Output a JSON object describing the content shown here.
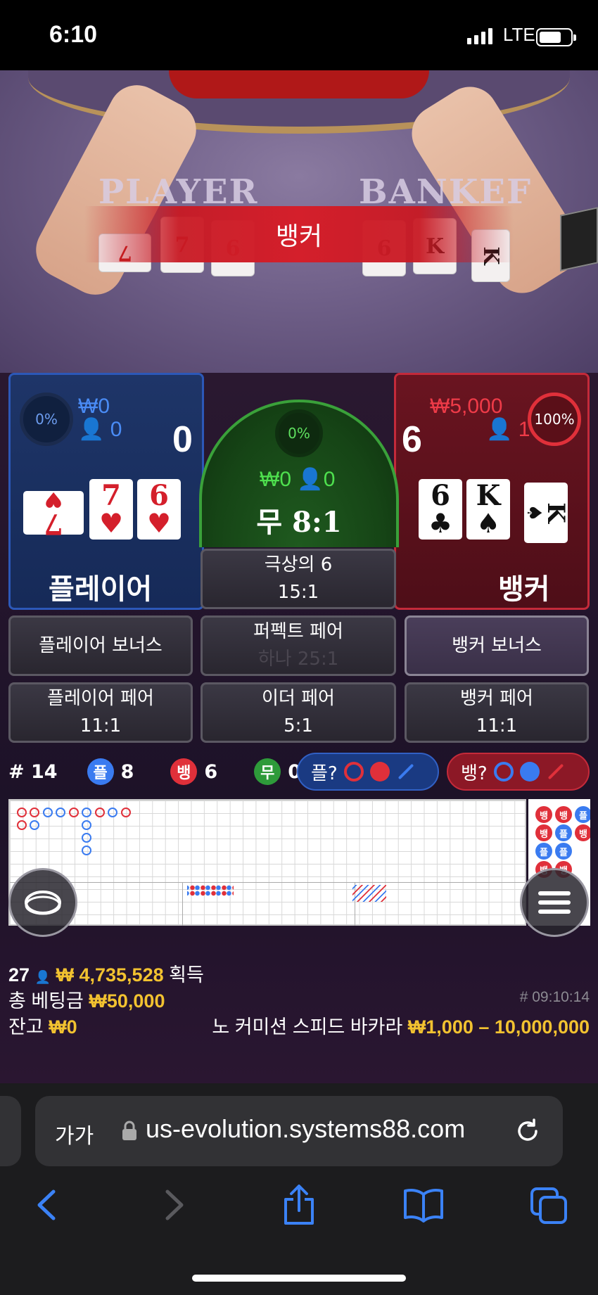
{
  "status_bar": {
    "time": "6:10",
    "network": "LTE"
  },
  "video": {
    "table_label_player": "PLAYER",
    "table_label_banker": "BANKEF",
    "result_banner": "뱅커",
    "player_cards_on_table": [
      {
        "rank": "7",
        "color": "red"
      },
      {
        "rank": "7",
        "color": "red"
      },
      {
        "rank": "6",
        "color": "red"
      }
    ],
    "banker_cards_on_table": [
      {
        "rank": "6",
        "color": "black"
      },
      {
        "rank": "K",
        "color": "black"
      },
      {
        "rank": "K",
        "color": "black"
      }
    ]
  },
  "player": {
    "percent": "0%",
    "bet": "₩0",
    "bettors": "0",
    "score": "0",
    "name": "플레이어",
    "cards": [
      {
        "rank": "7",
        "suit": "♥",
        "color": "red"
      },
      {
        "rank": "7",
        "suit": "♥",
        "color": "red"
      },
      {
        "rank": "6",
        "suit": "♥",
        "color": "red"
      }
    ]
  },
  "tie": {
    "percent": "0%",
    "bet": "₩0",
    "bettors": "0",
    "label": "무 8:1"
  },
  "banker": {
    "percent": "100%",
    "bet": "₩5,000",
    "bettors": "1",
    "score": "6",
    "name": "뱅커",
    "cards": [
      {
        "rank": "6",
        "suit": "♣",
        "color": "black"
      },
      {
        "rank": "K",
        "suit": "♠",
        "color": "black"
      },
      {
        "rank": "K",
        "suit": "♠",
        "color": "black"
      }
    ]
  },
  "side_bets": {
    "super6": {
      "label": "극상의 6",
      "odds": "15:1"
    },
    "player_bonus": {
      "label": "플레이어 보너스"
    },
    "perfect_pair": {
      "label": "퍼펙트 페어",
      "odds": "하나 25:1"
    },
    "banker_bonus": {
      "label": "뱅커 보너스"
    },
    "player_pair": {
      "label": "플레이어 페어",
      "odds": "11:1"
    },
    "either_pair": {
      "label": "이더 페어",
      "odds": "5:1"
    },
    "banker_pair": {
      "label": "뱅커 페어",
      "odds": "11:1"
    }
  },
  "stats": {
    "round": "# 14",
    "player_label": "플",
    "player_count": "8",
    "banker_label": "뱅",
    "banker_count": "6",
    "tie_label": "무",
    "tie_count": "0",
    "ask_player": "플?",
    "ask_banker": "뱅?"
  },
  "bead_road": [
    "뱅",
    "뱅",
    "플",
    "뱅",
    "플",
    "뱅",
    "플",
    "플",
    "뱅",
    "뱅"
  ],
  "colors": {
    "player_blue": "#3a7bf0",
    "banker_red": "#e0303a",
    "tie_green": "#2e9a3a",
    "gold": "#f2c230"
  },
  "footer_info": {
    "players_online": "27",
    "win_amount": "₩ 4,735,528",
    "win_label": "획득",
    "total_bet_label": "총 베팅금",
    "total_bet": "₩50,000",
    "game_id": "# 09:10:14",
    "balance_label": "잔고",
    "balance": "₩0",
    "table_name": "노 커미션 스피드 바카라",
    "table_limits": "₩1,000 – 10,000,000"
  },
  "browser": {
    "text_size": "가가",
    "url": "us-evolution.systems88.com"
  }
}
